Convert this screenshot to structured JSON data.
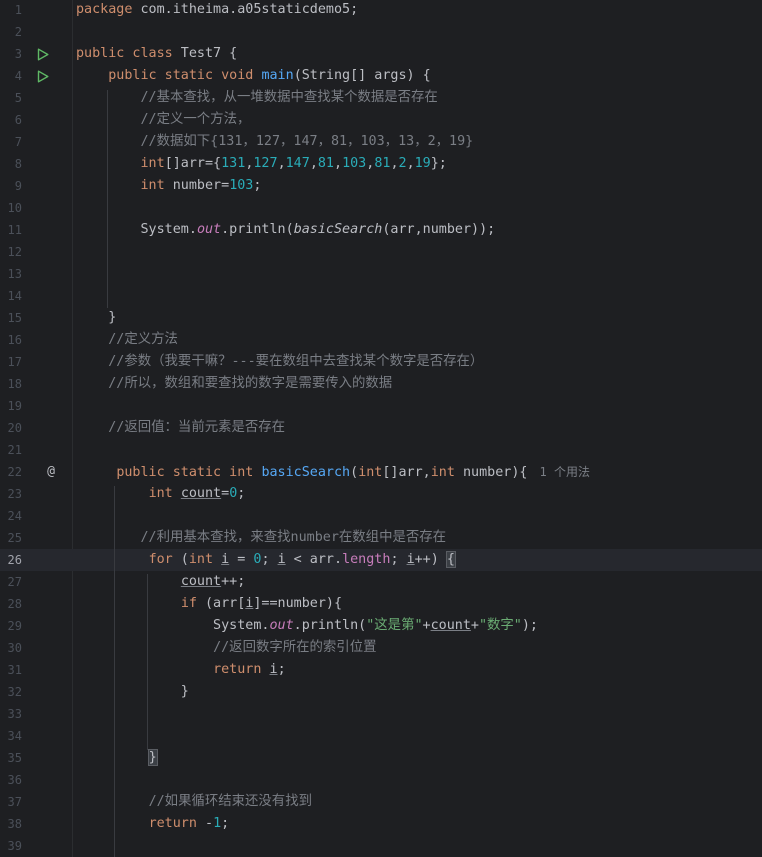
{
  "editor": {
    "current_line": 26,
    "lines": [
      {
        "n": "1",
        "tokens": [
          [
            "kw",
            "package"
          ],
          [
            "p",
            " com.itheima.a05staticdemo5;"
          ]
        ]
      },
      {
        "n": "2",
        "tokens": []
      },
      {
        "n": "3",
        "tokens": [
          [
            "kw",
            "public class"
          ],
          [
            "p",
            " Test7 {"
          ]
        ],
        "run": true
      },
      {
        "n": "4",
        "tokens": [
          [
            "p",
            "    "
          ],
          [
            "kw",
            "public static void"
          ],
          [
            "p",
            " "
          ],
          [
            "fn",
            "main"
          ],
          [
            "p",
            "(String[] args) {"
          ]
        ],
        "run": true
      },
      {
        "n": "5",
        "tokens": [
          [
            "p",
            "        "
          ],
          [
            "cm",
            "//基本查找，从一堆数据中查找某个数据是否存在"
          ]
        ]
      },
      {
        "n": "6",
        "tokens": [
          [
            "p",
            "        "
          ],
          [
            "cm",
            "//定义一个方法，"
          ]
        ]
      },
      {
        "n": "7",
        "tokens": [
          [
            "p",
            "        "
          ],
          [
            "cm",
            "//数据如下{131，127，147，81，103，13，2，19}"
          ]
        ]
      },
      {
        "n": "8",
        "tokens": [
          [
            "p",
            "        "
          ],
          [
            "kw",
            "int"
          ],
          [
            "p",
            "[]arr={"
          ],
          [
            "num",
            "131"
          ],
          [
            "p",
            ","
          ],
          [
            "num",
            "127"
          ],
          [
            "p",
            ","
          ],
          [
            "num",
            "147"
          ],
          [
            "p",
            ","
          ],
          [
            "num",
            "81"
          ],
          [
            "p",
            ","
          ],
          [
            "num",
            "103"
          ],
          [
            "p",
            ","
          ],
          [
            "num",
            "81"
          ],
          [
            "p",
            ","
          ],
          [
            "num",
            "2"
          ],
          [
            "p",
            ","
          ],
          [
            "num",
            "19"
          ],
          [
            "p",
            "};"
          ]
        ]
      },
      {
        "n": "9",
        "tokens": [
          [
            "p",
            "        "
          ],
          [
            "kw",
            "int"
          ],
          [
            "p",
            " number="
          ],
          [
            "num",
            "103"
          ],
          [
            "p",
            ";"
          ]
        ]
      },
      {
        "n": "10",
        "tokens": []
      },
      {
        "n": "11",
        "tokens": [
          [
            "p",
            "        System."
          ],
          [
            "fld",
            "out"
          ],
          [
            "p",
            ".println("
          ],
          [
            "call",
            "basicSearch"
          ],
          [
            "p",
            "(arr,number));"
          ]
        ]
      },
      {
        "n": "12",
        "tokens": []
      },
      {
        "n": "13",
        "tokens": []
      },
      {
        "n": "14",
        "tokens": []
      },
      {
        "n": "15",
        "tokens": [
          [
            "p",
            "    }"
          ]
        ]
      },
      {
        "n": "16",
        "tokens": [
          [
            "p",
            "    "
          ],
          [
            "cm",
            "//定义方法"
          ]
        ]
      },
      {
        "n": "17",
        "tokens": [
          [
            "p",
            "    "
          ],
          [
            "cm",
            "//参数（我要干嘛？---要在数组中去查找某个数字是否存在）"
          ]
        ]
      },
      {
        "n": "18",
        "tokens": [
          [
            "p",
            "    "
          ],
          [
            "cm",
            "//所以，数组和要查找的数字是需要传入的数据"
          ]
        ]
      },
      {
        "n": "19",
        "tokens": []
      },
      {
        "n": "20",
        "tokens": [
          [
            "p",
            "    "
          ],
          [
            "cm",
            "//返回值：当前元素是否存在"
          ]
        ]
      },
      {
        "n": "21",
        "tokens": []
      },
      {
        "n": "22",
        "tokens": [
          [
            "p",
            "     "
          ],
          [
            "kw",
            "public static int"
          ],
          [
            "p",
            " "
          ],
          [
            "fn",
            "basicSearch"
          ],
          [
            "p",
            "("
          ],
          [
            "kw",
            "int"
          ],
          [
            "p",
            "[]arr,"
          ],
          [
            "kw",
            "int"
          ],
          [
            "p",
            " number){"
          ],
          [
            "usage",
            "1 个用法"
          ]
        ],
        "impl": true
      },
      {
        "n": "23",
        "tokens": [
          [
            "p",
            "         "
          ],
          [
            "kw",
            "int"
          ],
          [
            "p",
            " "
          ],
          [
            "ul",
            "count"
          ],
          [
            "p",
            "="
          ],
          [
            "num",
            "0"
          ],
          [
            "p",
            ";"
          ]
        ]
      },
      {
        "n": "24",
        "tokens": []
      },
      {
        "n": "25",
        "tokens": [
          [
            "p",
            "        "
          ],
          [
            "cm",
            "//利用基本查找，来查找number在数组中是否存在"
          ]
        ]
      },
      {
        "n": "26",
        "tokens": [
          [
            "p",
            "         "
          ],
          [
            "kw",
            "for"
          ],
          [
            "p",
            " ("
          ],
          [
            "kw",
            "int"
          ],
          [
            "p",
            " "
          ],
          [
            "ul",
            "i"
          ],
          [
            "p",
            " = "
          ],
          [
            "num",
            "0"
          ],
          [
            "p",
            "; "
          ],
          [
            "ul",
            "i"
          ],
          [
            "p",
            " < arr."
          ],
          [
            "fld2",
            "length"
          ],
          [
            "p",
            "; "
          ],
          [
            "ul",
            "i"
          ],
          [
            "p",
            "++) "
          ],
          [
            "brace",
            "{"
          ]
        ]
      },
      {
        "n": "27",
        "tokens": [
          [
            "p",
            "             "
          ],
          [
            "ul",
            "count"
          ],
          [
            "p",
            "++;"
          ]
        ]
      },
      {
        "n": "28",
        "tokens": [
          [
            "p",
            "             "
          ],
          [
            "kw",
            "if"
          ],
          [
            "p",
            " (arr["
          ],
          [
            "ul",
            "i"
          ],
          [
            "p",
            "]==number){"
          ]
        ]
      },
      {
        "n": "29",
        "tokens": [
          [
            "p",
            "                 System."
          ],
          [
            "fld",
            "out"
          ],
          [
            "p",
            ".println("
          ],
          [
            "str",
            "\"这是第\""
          ],
          [
            "p",
            "+"
          ],
          [
            "ul",
            "count"
          ],
          [
            "p",
            "+"
          ],
          [
            "str",
            "\"数字\""
          ],
          [
            "p",
            ");"
          ]
        ]
      },
      {
        "n": "30",
        "tokens": [
          [
            "p",
            "                 "
          ],
          [
            "cm",
            "//返回数字所在的索引位置"
          ]
        ]
      },
      {
        "n": "31",
        "tokens": [
          [
            "p",
            "                 "
          ],
          [
            "kw",
            "return"
          ],
          [
            "p",
            " "
          ],
          [
            "ul",
            "i"
          ],
          [
            "p",
            ";"
          ]
        ]
      },
      {
        "n": "32",
        "tokens": [
          [
            "p",
            "             }"
          ]
        ]
      },
      {
        "n": "33",
        "tokens": []
      },
      {
        "n": "34",
        "tokens": []
      },
      {
        "n": "35",
        "tokens": [
          [
            "p",
            "         "
          ],
          [
            "brace",
            "}"
          ]
        ]
      },
      {
        "n": "36",
        "tokens": []
      },
      {
        "n": "37",
        "tokens": [
          [
            "p",
            "         "
          ],
          [
            "cm",
            "//如果循环结束还没有找到"
          ]
        ]
      },
      {
        "n": "38",
        "tokens": [
          [
            "p",
            "         "
          ],
          [
            "kw",
            "return"
          ],
          [
            "p",
            " -"
          ],
          [
            "num",
            "1"
          ],
          [
            "p",
            ";"
          ]
        ]
      },
      {
        "n": "39",
        "tokens": []
      }
    ]
  },
  "icons": {
    "run_icon": "run-gutter-icon",
    "impl_icon": "at-override-icon",
    "impl_glyph": "@"
  },
  "colors": {
    "background": "#1e1f22",
    "keyword": "#cf8e6d",
    "function": "#56a8f5",
    "number": "#2aacb8",
    "comment": "#7a7e85",
    "string": "#6aab73",
    "field": "#c77dbb",
    "run_green": "#5fb865"
  }
}
